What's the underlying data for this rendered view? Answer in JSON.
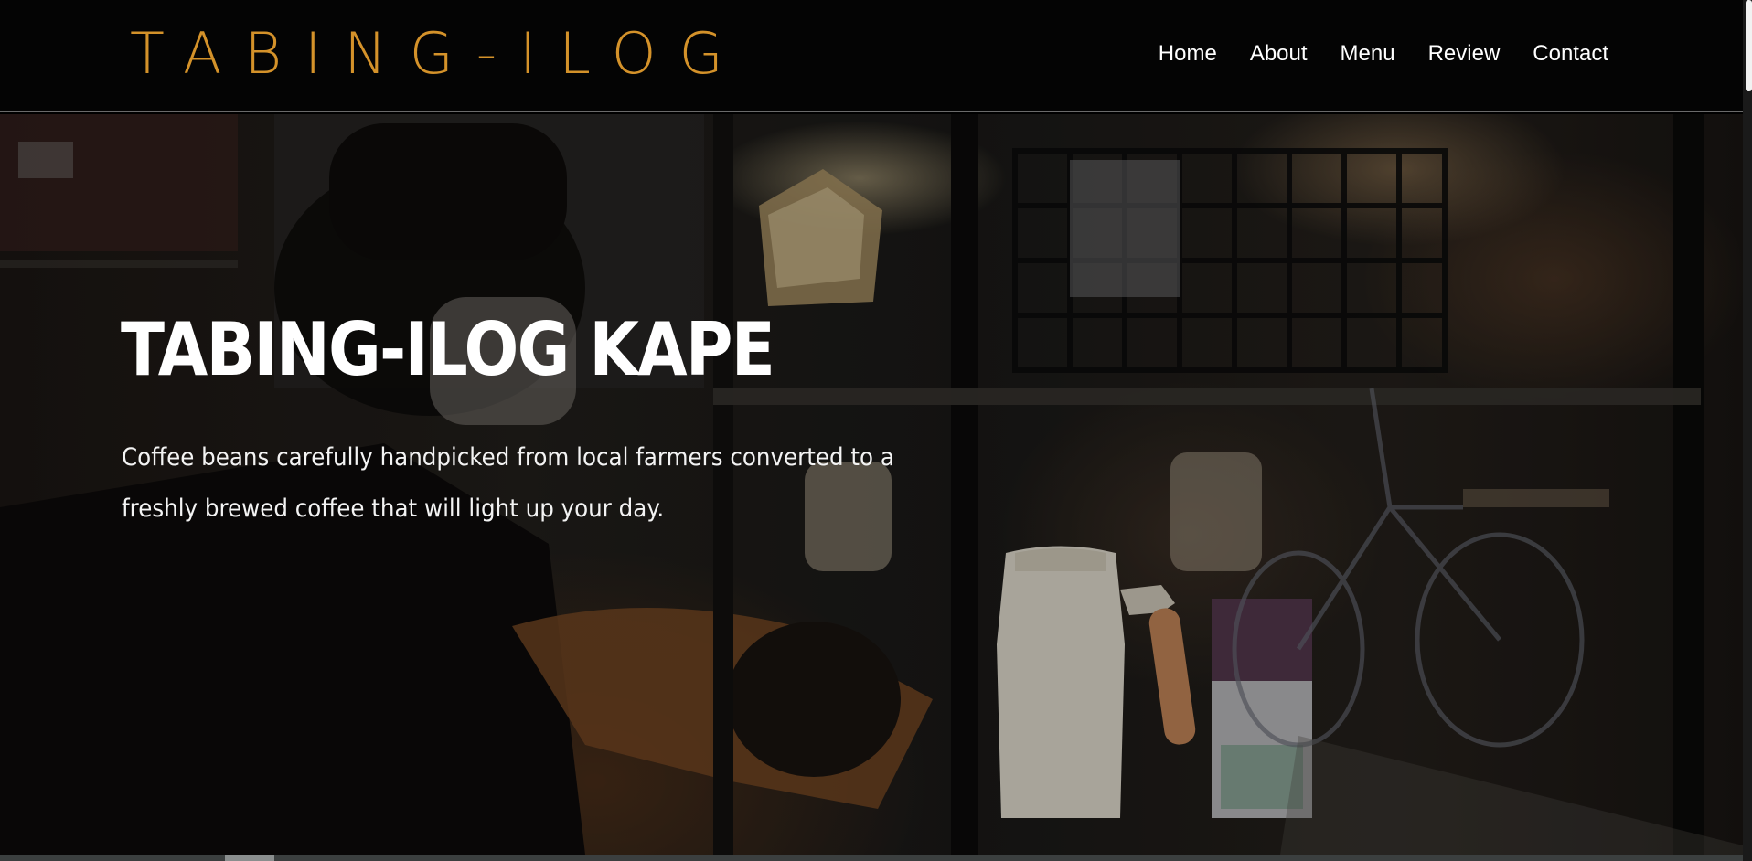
{
  "header": {
    "logo": "TABING-ILOG",
    "nav": [
      "Home",
      "About",
      "Menu",
      "Review",
      "Contact"
    ]
  },
  "hero": {
    "title": "TABING-ILOG KAPE",
    "subtitle": "Coffee beans carefully handpicked from local farmers converted to a freshly brewed coffee that will light up your day."
  },
  "colors": {
    "logo": "#d4922a",
    "header_bg": "#040404",
    "text": "#ffffff"
  }
}
